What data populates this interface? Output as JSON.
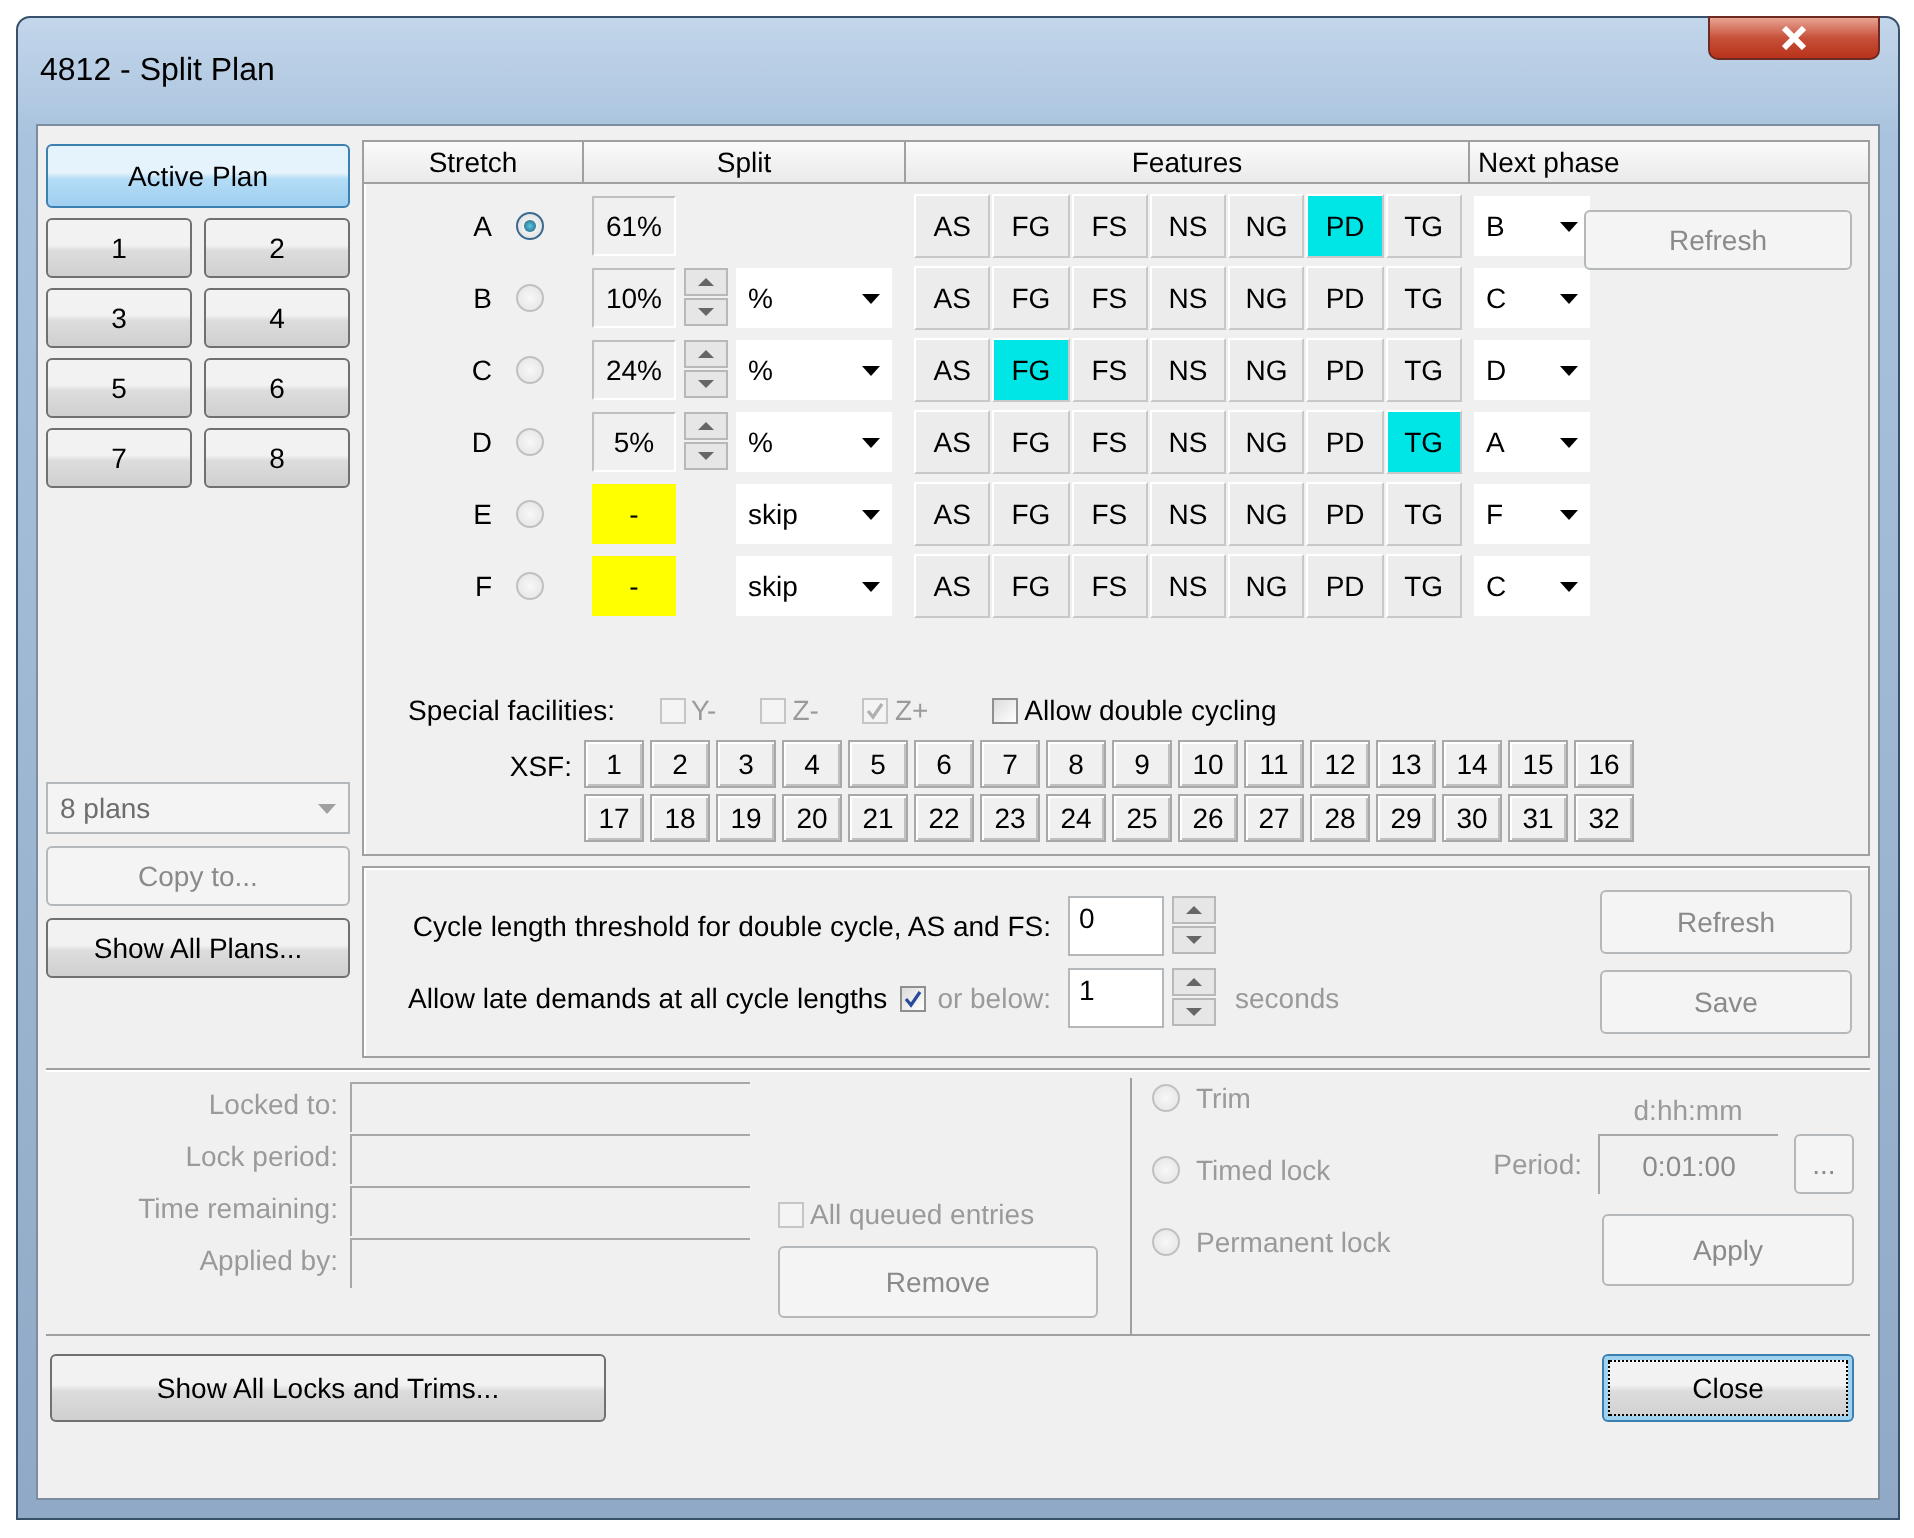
{
  "window": {
    "title": "4812 - Split Plan"
  },
  "plan_buttons": [
    {
      "label": "Active Plan",
      "selected": true
    },
    {
      "label": "1",
      "selected": false
    },
    {
      "label": "2",
      "selected": false
    },
    {
      "label": "3",
      "selected": false
    },
    {
      "label": "4",
      "selected": false
    },
    {
      "label": "5",
      "selected": false
    },
    {
      "label": "6",
      "selected": false
    },
    {
      "label": "7",
      "selected": false
    },
    {
      "label": "8",
      "selected": false
    }
  ],
  "plan_count": {
    "value": "8 plans",
    "disabled": true
  },
  "copy_button": {
    "label": "Copy to...",
    "disabled": true
  },
  "show_plans_button": {
    "label": "Show All Plans...",
    "disabled": false
  },
  "table": {
    "columns": [
      "Stretch",
      "Split",
      "Features",
      "Next phase"
    ],
    "rows": [
      {
        "stretch": "A",
        "selected": true,
        "split": "61%",
        "kind": "fixed",
        "features": [
          {
            "label": "AS",
            "on": false
          },
          {
            "label": "FG",
            "on": false
          },
          {
            "label": "FS",
            "on": false
          },
          {
            "label": "NS",
            "on": false
          },
          {
            "label": "NG",
            "on": false
          },
          {
            "label": "PD",
            "on": true
          },
          {
            "label": "TG",
            "on": false
          }
        ],
        "next": "B"
      },
      {
        "stretch": "B",
        "selected": false,
        "split": "10%",
        "kind": "spin",
        "mode": "%",
        "features": [
          {
            "label": "AS",
            "on": false
          },
          {
            "label": "FG",
            "on": false
          },
          {
            "label": "FS",
            "on": false
          },
          {
            "label": "NS",
            "on": false
          },
          {
            "label": "NG",
            "on": false
          },
          {
            "label": "PD",
            "on": false
          },
          {
            "label": "TG",
            "on": false
          }
        ],
        "next": "C"
      },
      {
        "stretch": "C",
        "selected": false,
        "split": "24%",
        "kind": "spin",
        "mode": "%",
        "features": [
          {
            "label": "AS",
            "on": false
          },
          {
            "label": "FG",
            "on": true
          },
          {
            "label": "FS",
            "on": false
          },
          {
            "label": "NS",
            "on": false
          },
          {
            "label": "NG",
            "on": false
          },
          {
            "label": "PD",
            "on": false
          },
          {
            "label": "TG",
            "on": false
          }
        ],
        "next": "D"
      },
      {
        "stretch": "D",
        "selected": false,
        "split": "5%",
        "kind": "spin",
        "mode": "%",
        "features": [
          {
            "label": "AS",
            "on": false
          },
          {
            "label": "FG",
            "on": false
          },
          {
            "label": "FS",
            "on": false
          },
          {
            "label": "NS",
            "on": false
          },
          {
            "label": "NG",
            "on": false
          },
          {
            "label": "PD",
            "on": false
          },
          {
            "label": "TG",
            "on": true
          }
        ],
        "next": "A"
      },
      {
        "stretch": "E",
        "selected": false,
        "split": "-",
        "kind": "skip",
        "mode": "skip",
        "features": [
          {
            "label": "AS",
            "on": false
          },
          {
            "label": "FG",
            "on": false
          },
          {
            "label": "FS",
            "on": false
          },
          {
            "label": "NS",
            "on": false
          },
          {
            "label": "NG",
            "on": false
          },
          {
            "label": "PD",
            "on": false
          },
          {
            "label": "TG",
            "on": false
          }
        ],
        "next": "F"
      },
      {
        "stretch": "F",
        "selected": false,
        "split": "-",
        "kind": "skip",
        "mode": "skip",
        "features": [
          {
            "label": "AS",
            "on": false
          },
          {
            "label": "FG",
            "on": false
          },
          {
            "label": "FS",
            "on": false
          },
          {
            "label": "NS",
            "on": false
          },
          {
            "label": "NG",
            "on": false
          },
          {
            "label": "PD",
            "on": false
          },
          {
            "label": "TG",
            "on": false
          }
        ],
        "next": "C"
      }
    ]
  },
  "table_refresh_button": {
    "label": "Refresh",
    "disabled": true
  },
  "special_facilities": {
    "label": "Special facilities:",
    "options": [
      {
        "label": "Y-",
        "checked": false,
        "disabled": true
      },
      {
        "label": "Z-",
        "checked": false,
        "disabled": true
      },
      {
        "label": "Z+",
        "checked": true,
        "disabled": true
      },
      {
        "label": "Allow double cycling",
        "checked": false,
        "disabled": false
      }
    ]
  },
  "xsf": {
    "label": "XSF:",
    "buttons": [
      "1",
      "2",
      "3",
      "4",
      "5",
      "6",
      "7",
      "8",
      "9",
      "10",
      "11",
      "12",
      "13",
      "14",
      "15",
      "16",
      "17",
      "18",
      "19",
      "20",
      "21",
      "22",
      "23",
      "24",
      "25",
      "26",
      "27",
      "28",
      "29",
      "30",
      "31",
      "32"
    ]
  },
  "cycle": {
    "threshold_label": "Cycle length threshold for double cycle,  AS and FS:",
    "threshold_value": "0",
    "late_label": "Allow late demands at all cycle lengths",
    "late_checked": true,
    "below_label": "or below:",
    "below_value": "1",
    "seconds_label": "seconds",
    "refresh_button": {
      "label": "Refresh",
      "disabled": true
    },
    "save_button": {
      "label": "Save",
      "disabled": true
    }
  },
  "locks": {
    "fields": [
      {
        "label": "Locked to:"
      },
      {
        "label": "Lock period:"
      },
      {
        "label": "Time remaining:"
      },
      {
        "label": "Applied by:"
      }
    ],
    "all_queued": {
      "label": "All queued entries",
      "checked": false
    },
    "remove_button": {
      "label": "Remove",
      "disabled": true
    },
    "options": [
      {
        "label": "Trim",
        "selected": false
      },
      {
        "label": "Timed lock",
        "selected": false
      },
      {
        "label": "Permanent lock",
        "selected": false
      }
    ],
    "format_hint": "d:hh:mm",
    "period_label": "Period:",
    "period_value": "0:01:00",
    "browse_button": "...",
    "apply_button": {
      "label": "Apply",
      "disabled": true
    }
  },
  "footer": {
    "locks_button": "Show All Locks and Trims...",
    "close_button": "Close"
  }
}
